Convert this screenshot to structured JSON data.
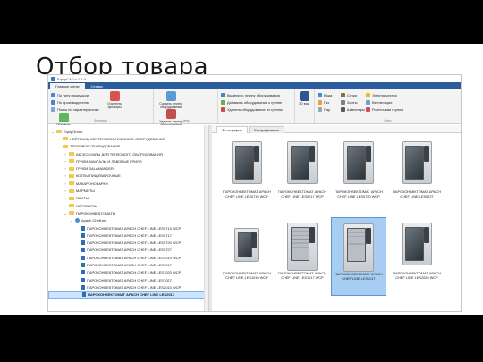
{
  "slide_title": "Отбор товара",
  "app": {
    "title": "EquipCAD v 1.1.0",
    "ribbon_tabs": [
      "Главное меню",
      "Сервис"
    ],
    "groups": {
      "filter": {
        "items": [
          "По типу продукции",
          "По производителю",
          "Поиск по характеристике"
        ],
        "big_buttons": [
          "Очистить фильтры",
          "Обновить"
        ],
        "label": "Фильтры"
      },
      "group": {
        "big_buttons": [
          "Создать группу оборудования",
          "Удалить группу оборудования"
        ],
        "label": "Цепь"
      },
      "select": {
        "items": [
          "Выделить группу оборудования",
          "Добавить оборудование к группе",
          "Удалить оборудование из группы"
        ]
      },
      "view": {
        "big_button": "3D вид"
      },
      "comms": {
        "items": [
          "Вода",
          "Газ",
          "Пар",
          "Стоки",
          "Зонты",
          "Швеллеры",
          "Дверь",
          "Электричество",
          "Вентиляция",
          "Производство",
          "Розеточная группа",
          "Освещение"
        ],
        "label": "Сети"
      }
    },
    "tree": [
      {
        "level": 0,
        "label": "EquipGroup",
        "icon": "folder"
      },
      {
        "level": 1,
        "label": "НЕЙТРАЛЬНОЕ ТЕХНОЛОГИЧЕСКОЕ ОБОРУДОВАНИЕ",
        "icon": "folder"
      },
      {
        "level": 1,
        "label": "ТЕПЛОВОЕ ОБОРУДОВАНИЕ",
        "icon": "folder"
      },
      {
        "level": 2,
        "label": "АКСЕССУАРЫ ДЛЯ ТЕПЛОВОГО ОБОРУДОВАНИЯ",
        "icon": "folder"
      },
      {
        "level": 2,
        "label": "ГРИЛИ-МАНГАЛЫ И ЛАВОВЫЕ ГРИЛИ",
        "icon": "folder"
      },
      {
        "level": 2,
        "label": "ГРИЛИ SALAMANDER",
        "icon": "folder"
      },
      {
        "level": 2,
        "label": "КОТЛЫ ПИЩЕВАРОЧНЫЕ",
        "icon": "folder"
      },
      {
        "level": 2,
        "label": "МАКАРОНОВАРКИ",
        "icon": "folder"
      },
      {
        "level": 2,
        "label": "МАРМИТЫ",
        "icon": "folder"
      },
      {
        "level": 2,
        "label": "ПЛИТЫ",
        "icon": "folder"
      },
      {
        "level": 2,
        "label": "ПАРОВАРКИ",
        "icon": "folder"
      },
      {
        "level": 2,
        "label": "ПАРОКОНВЕКТОМАТЫ",
        "icon": "folder"
      },
      {
        "level": 3,
        "label": "Apach ChefLine",
        "icon": "gear"
      },
      {
        "level": 4,
        "label": "ПАРОКОНВЕКТОМАТ APACH CHEF LINE LES0710 WCP",
        "icon": "doc"
      },
      {
        "level": 4,
        "label": "ПАРОКОНВЕКТОМАТ APACH CHEF LINE LES0717",
        "icon": "doc"
      },
      {
        "level": 4,
        "label": "ПАРОКОНВЕКТОМАТ APACH CHEF LINE LES0720 WCP",
        "icon": "doc"
      },
      {
        "level": 4,
        "label": "ПАРОКОНВЕКТОМАТ APACH CHEF LINE LES0727",
        "icon": "doc"
      },
      {
        "level": 4,
        "label": "ПАРОКОНВЕКТОМАТ APACH CHEF LINE LES1010 WCP",
        "icon": "doc"
      },
      {
        "level": 4,
        "label": "ПАРОКОНВЕКТОМАТ APACH CHEF LINE LES1017",
        "icon": "doc"
      },
      {
        "level": 4,
        "label": "ПАРОКОНВЕКТОМАТ APACH CHEF LINE LES1020 WCP",
        "icon": "doc"
      },
      {
        "level": 4,
        "label": "ПАРОКОНВЕКТОМАТ APACH CHEF LINE LES1027",
        "icon": "doc"
      },
      {
        "level": 4,
        "label": "ПАРОКОНВЕКТОМАТ APACH CHEF LINE LES2010 WCP",
        "icon": "doc"
      },
      {
        "level": 4,
        "label": "ПАРОКОНВЕКТОМАТ APACH CHEF LINE LES2017",
        "icon": "doc",
        "selected": true
      }
    ],
    "panel_tabs": [
      "Фотографии",
      "Спецификация"
    ],
    "products": [
      {
        "label": "ПАРОКОНВЕКТОМАТ APACH CHEF LINE LES0710 WCP"
      },
      {
        "label": "ПАРОКОНВЕКТОМАТ APACH CHEF LINE LES0717 WCP"
      },
      {
        "label": "ПАРОКОНВЕКТОМАТ APACH CHEF LINE LES0720 WCP"
      },
      {
        "label": "ПАРОКОНВЕКТОМАТ APACH CHEF LINE LES0727"
      },
      {
        "label": "ПАРОКОНВЕКТОМАТ APACH CHEF LINE LES1010 WCP"
      },
      {
        "label": "ПАРОКОНВЕКТОМАТ APACH CHEF LINE LES1017 WCP"
      },
      {
        "label": "ПАРОКОНВЕКТОМАТ APACH CHEF LINE LES2017",
        "selected": true
      },
      {
        "label": "ПАРОКОНВЕКТОМАТ APACH CHEF LINE LES2020 WCP"
      }
    ]
  }
}
